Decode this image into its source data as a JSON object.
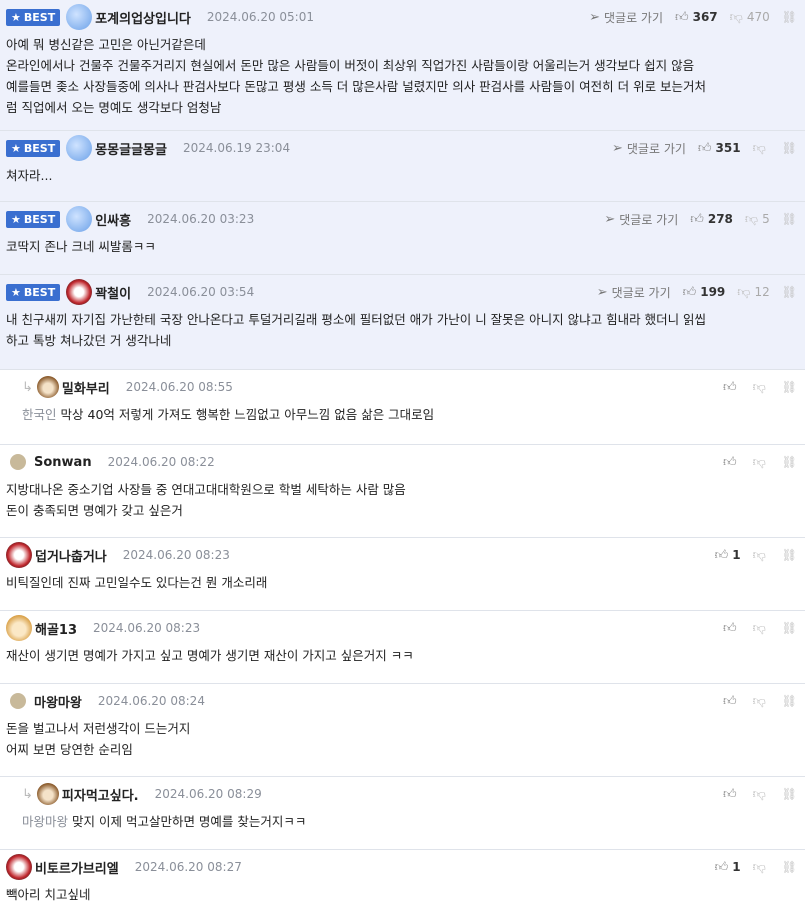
{
  "best_label": "BEST",
  "reply_link_label": "댓글로 가기",
  "comments": [
    {
      "nick": "포계의업상입니다",
      "date": "2024.06.20 05:01",
      "up": "367",
      "down": "470",
      "lines": [
        "아예 뭐 병신같은 고민은 아닌거같은데",
        "온라인에서나 건물주 건물주거리지 현실에서 돈만 많은 사람들이 버젓이 최상위 직업가진 사람들이랑 어울리는거 생각보다 쉽지 않음",
        "예를들면 좆소 사장들중에 의사나 판검사보다 돈많고 평생 소득 더 많은사람 널렸지만 의사 판검사를 사람들이 여전히 더 위로 보는거처",
        "럼 직업에서 오는 명예도 생각보다 엄청남"
      ]
    },
    {
      "nick": "몽몽글글몽글",
      "date": "2024.06.19 23:04",
      "up": "351",
      "down": "",
      "lines": [
        "쳐자라..."
      ]
    },
    {
      "nick": "인싸흥",
      "date": "2024.06.20 03:23",
      "up": "278",
      "down": "5",
      "lines": [
        "코딱지 존나 크네 씨발롬ㅋㅋ"
      ]
    },
    {
      "nick": "꽉철이",
      "date": "2024.06.20 03:54",
      "up": "199",
      "down": "12",
      "lines": [
        "내 친구새끼 자기집 가난한테 국장 안나온다고 투덜거리길래 평소에 필터없던 애가 가난이 니 잘못은 아니지 않냐고 힘내라 했더니 읽씹",
        "하고 톡방 쳐나갔던 거 생각나네"
      ]
    },
    {
      "nick": "밀화부리",
      "date": "2024.06.20 08:55",
      "up": "",
      "down": "",
      "mention": "한국인",
      "lines": [
        "막상 40억 저렇게 가져도 행복한 느낌없고 아무느낌 없음 삶은 그대로임"
      ]
    },
    {
      "nick": "Sonwan",
      "date": "2024.06.20 08:22",
      "up": "",
      "down": "",
      "lines": [
        "지방대나온 중소기업 사장들 중 연대고대대학원으로 학벌 세탁하는 사람 많음",
        "돈이 충족되면 명예가 갖고 싶은거"
      ]
    },
    {
      "nick": "덥거나춥거나",
      "date": "2024.06.20 08:23",
      "up": "1",
      "down": "",
      "lines": [
        "비틱질인데 진짜 고민일수도 있다는건 뭔 개소리래"
      ]
    },
    {
      "nick": "해골13",
      "date": "2024.06.20 08:23",
      "up": "",
      "down": "",
      "lines": [
        "재산이 생기면 명예가 가지고 싶고 명예가 생기면 재산이 가지고 싶은거지 ㅋㅋ"
      ]
    },
    {
      "nick": "마왕마왕",
      "date": "2024.06.20 08:24",
      "up": "",
      "down": "",
      "lines": [
        "돈을 벌고나서 저런생각이 드는거지",
        "어찌 보면 당연한 순리임"
      ]
    },
    {
      "nick": "피자먹고싶다.",
      "date": "2024.06.20 08:29",
      "up": "",
      "down": "",
      "mention": "마왕마왕",
      "lines": [
        "맞지 이제 먹고살만하면 명예를 찾는거지ㅋㅋ"
      ]
    },
    {
      "nick": "비토르가브리엘",
      "date": "2024.06.20 08:27",
      "up": "1",
      "down": "",
      "lines": [
        "빽아리 치고싶네"
      ]
    }
  ],
  "colors": {
    "best_bg": "#eef1fb",
    "badge": "#3a6fd0"
  },
  "icons": {
    "up": "thumbs-up-icon",
    "down": "thumbs-down-icon",
    "link": "link-icon",
    "reply": "send-icon",
    "reply_arrow": "reply-arrow-icon"
  }
}
